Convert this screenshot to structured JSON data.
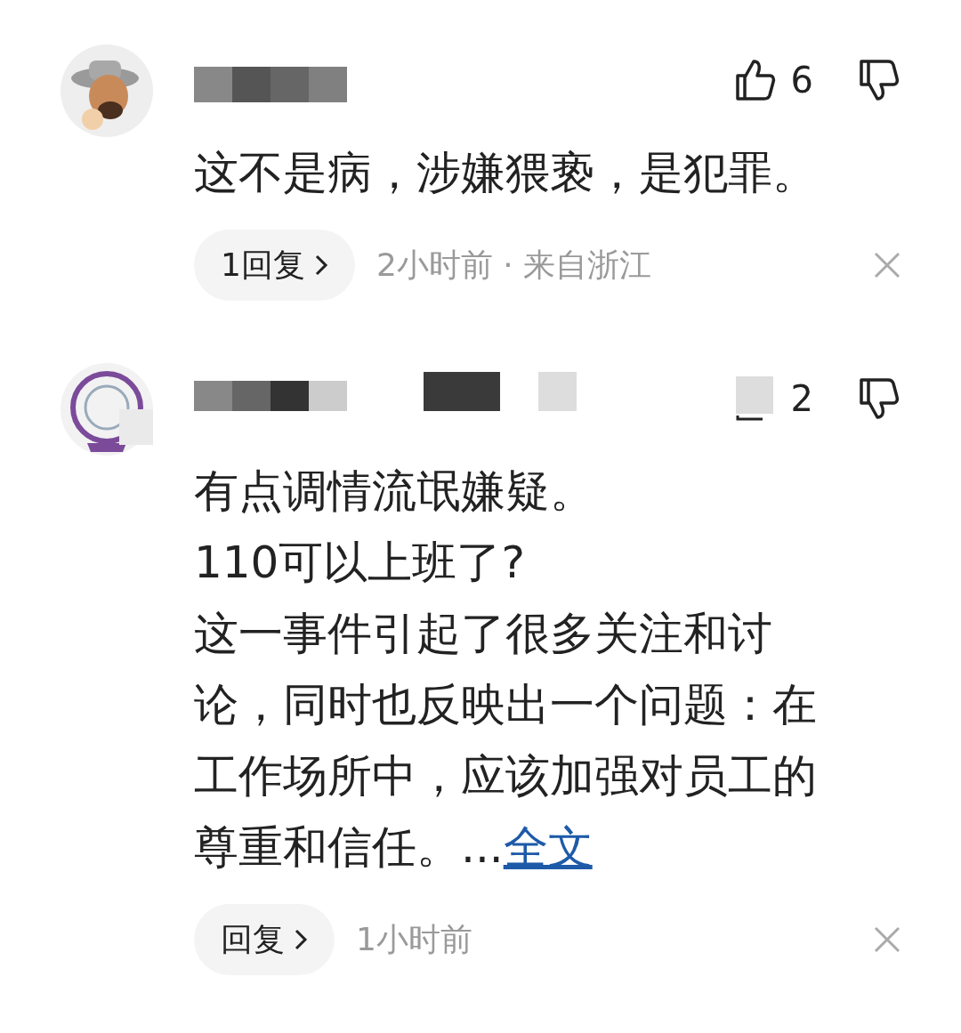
{
  "comments": [
    {
      "like_count": "6",
      "text": "这不是病，涉嫌猥亵，是犯罪。",
      "reply_label": "1回复",
      "meta": "2小时前 · 来自浙江"
    },
    {
      "like_count": "2",
      "text": "有点调情流氓嫌疑。\n110可以上班了?\n这一事件引起了很多关注和讨论，同时也反映出一个问题：在工作场所中，应该加强对员工的尊重和信任。...",
      "more_link": "全文",
      "reply_label": "回复",
      "meta": "1小时前"
    }
  ]
}
